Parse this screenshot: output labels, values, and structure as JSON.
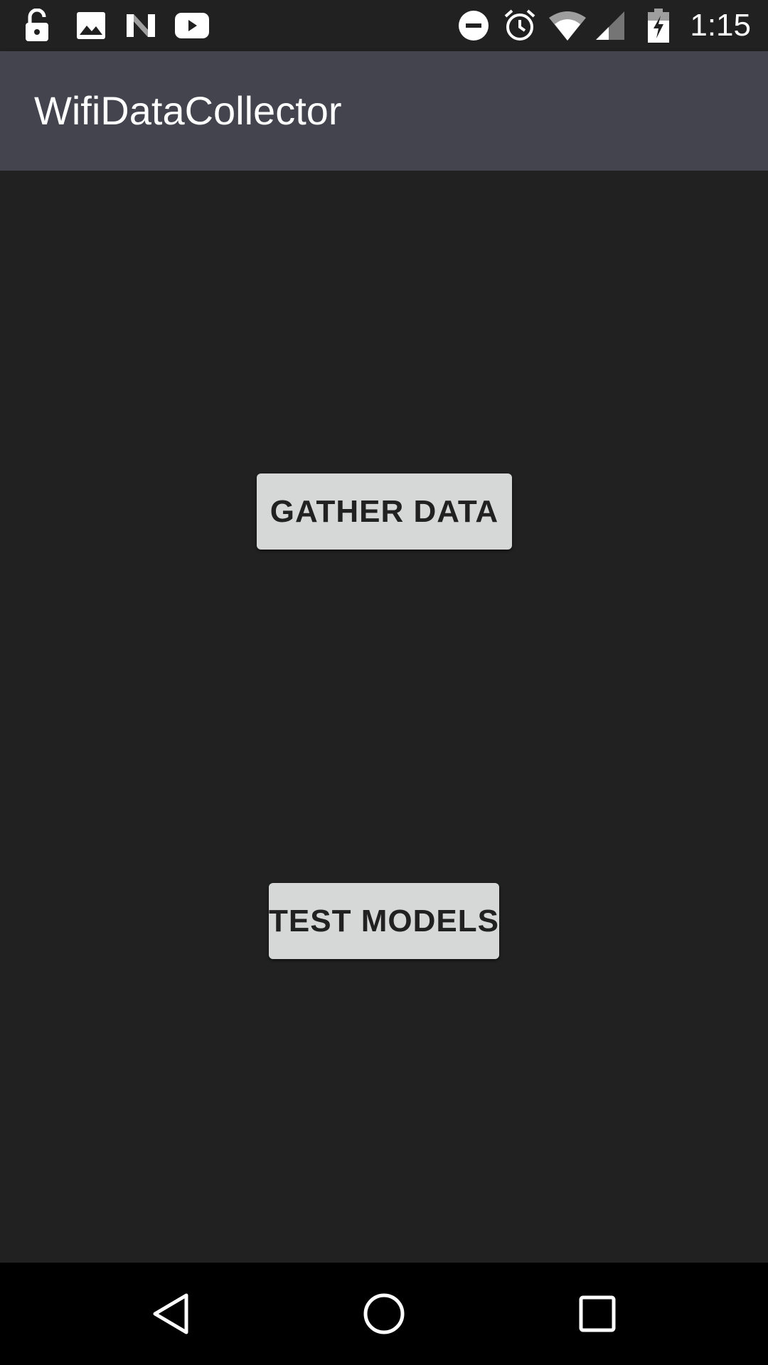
{
  "status_bar": {
    "time": "1:15",
    "left_icons": [
      "lock-open-icon",
      "image-icon",
      "n-logo-icon",
      "youtube-icon"
    ],
    "right_icons": [
      "do-not-disturb-icon",
      "alarm-icon",
      "wifi-icon",
      "cell-signal-icon",
      "battery-charging-icon"
    ]
  },
  "app_bar": {
    "title": "WifiDataCollector",
    "color": "#43444e"
  },
  "main": {
    "gather_button_label": "GATHER DATA",
    "test_button_label": "TEST MODELS",
    "background": "#212121",
    "button_color": "#d6d7d7"
  },
  "nav_bar": {
    "icons": [
      "back-icon",
      "home-icon",
      "recents-icon"
    ]
  }
}
